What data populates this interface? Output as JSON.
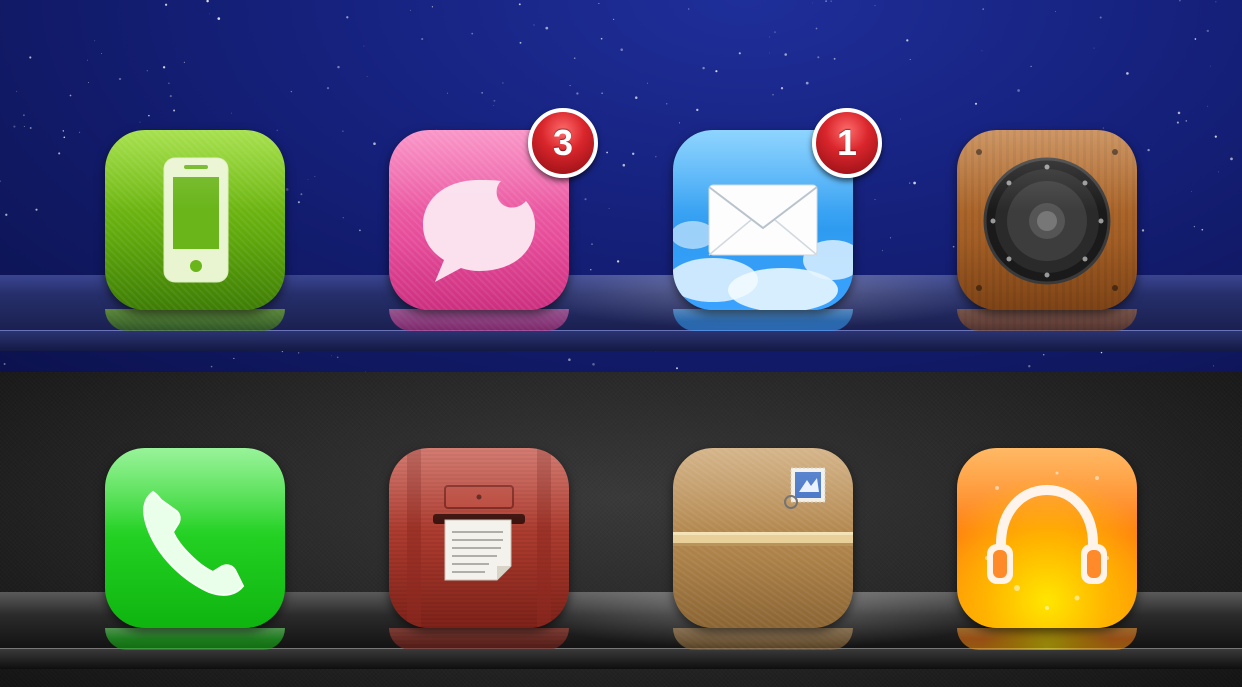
{
  "dock_top": {
    "icons": [
      {
        "id": "device",
        "icon": "smartphone-icon",
        "badge": null
      },
      {
        "id": "messages",
        "icon": "chat-bubble-icon",
        "badge": "3"
      },
      {
        "id": "mail",
        "icon": "envelope-icon",
        "badge": "1"
      },
      {
        "id": "speaker",
        "icon": "speaker-icon",
        "badge": null
      }
    ],
    "badges": {
      "messages": "3",
      "mail": "1"
    },
    "colors": {
      "background": "#15207a",
      "shelf": "#262f6b"
    }
  },
  "dock_bottom": {
    "icons": [
      {
        "id": "phone",
        "icon": "phone-handset-icon",
        "badge": null
      },
      {
        "id": "mailbox",
        "icon": "mailbox-icon",
        "badge": null
      },
      {
        "id": "package",
        "icon": "parcel-icon",
        "badge": null
      },
      {
        "id": "music",
        "icon": "headphones-icon",
        "badge": null
      }
    ],
    "colors": {
      "background": "#262626",
      "shelf": "#2b2b2b"
    }
  },
  "colors": {
    "badge": "#d9262c"
  }
}
